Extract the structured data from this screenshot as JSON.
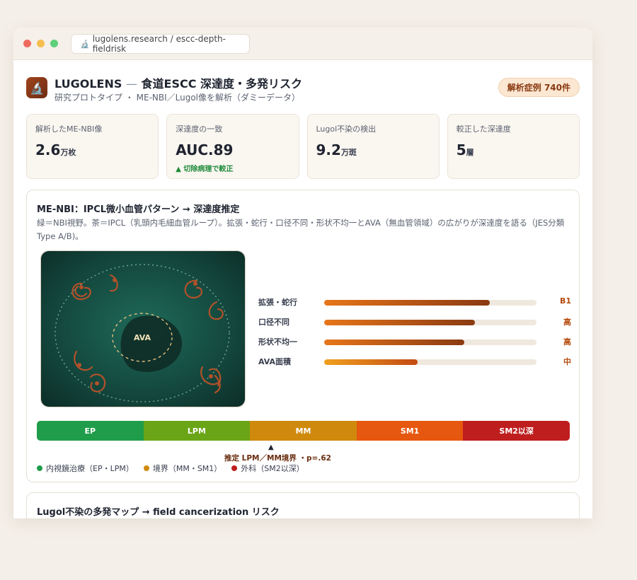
{
  "browser": {
    "url": "lugolens.research / escc-depth-fieldrisk",
    "url_icon": "microscope-icon"
  },
  "header": {
    "title_brand": "LUGOLENS",
    "title_dash": "—",
    "title_rest": "食道ESCC 深達度・多発リスク",
    "subtitle": "研究プロトタイプ ・ ME-NBI／Lugol像を解析（ダミーデータ）",
    "badge": "解析症例 740件"
  },
  "stats": [
    {
      "label": "解析したME-NBI像",
      "value": "2.6",
      "unit": "万枚",
      "note": ""
    },
    {
      "label": "深達度の一致",
      "value": "AUC.89",
      "unit": "",
      "note": "▲ 切除病理で較正"
    },
    {
      "label": "Lugol不染の検出",
      "value": "9.2",
      "unit": "万斑",
      "note": ""
    },
    {
      "label": "較正した深達度",
      "value": "5",
      "unit": "層",
      "note": ""
    }
  ],
  "nbi_card": {
    "title": "ME-NBI：IPCL微小血管パターン → 深達度推定",
    "desc": "緑＝NBI視野。茶＝IPCL（乳頭内毛細血管ループ）。拡張・蛇行・口径不同・形状不均一とAVA（無血管領域）の広がりが深達度を語る（JES分類 Type A/B)。",
    "ava_label": "AVA",
    "bars": [
      {
        "label": "拡張・蛇行",
        "value": "B1",
        "fraction": 0.78
      },
      {
        "label": "口径不同",
        "value": "高",
        "fraction": 0.71
      },
      {
        "label": "形状不均一",
        "value": "高",
        "fraction": 0.66
      },
      {
        "label": "AVA面積",
        "value": "中",
        "fraction": 0.44
      }
    ],
    "depth_scale": [
      "EP",
      "LPM",
      "MM",
      "SM1",
      "SM2以深"
    ],
    "depth_colors": [
      "#1f9d4a",
      "#6aa517",
      "#cf8a0e",
      "#e6570f",
      "#bf1e1e"
    ],
    "marker_symbol": "▲",
    "marker_label": "推定 LPM／MM境界 ・p=.62",
    "legend": [
      {
        "label": "内視鏡治療（EP・LPM）",
        "color": "#1f9d4a"
      },
      {
        "label": "境界（MM・SM1）",
        "color": "#cf8a0e"
      },
      {
        "label": "外科（SM2以深）",
        "color": "#bf1e1e"
      }
    ]
  },
  "lugol_card": {
    "title": "Lugol不染の多発マップ → field cancerization リスク"
  }
}
